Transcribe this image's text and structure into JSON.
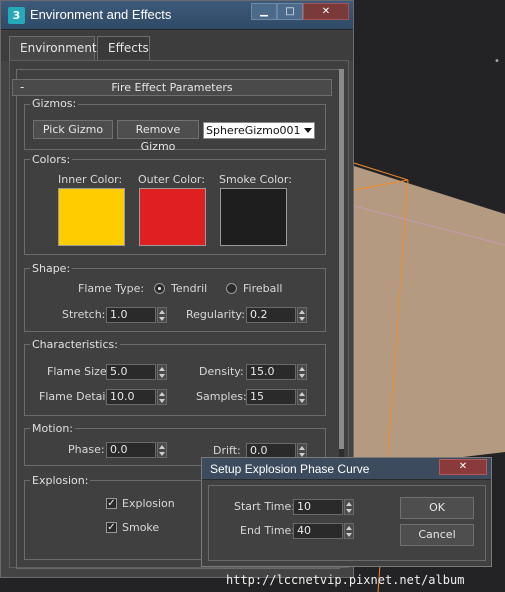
{
  "window": {
    "title": "Environment and Effects",
    "logo": "3"
  },
  "tabs": [
    {
      "label": "Environment",
      "active": true
    },
    {
      "label": "Effects",
      "active": false
    }
  ],
  "rollout": {
    "collapse_symbol": "-",
    "title": "Fire Effect Parameters"
  },
  "gizmos": {
    "group_label": "Gizmos:",
    "pick_label": "Pick Gizmo",
    "remove_label": "Remove Gizmo",
    "selected": "SphereGizmo001"
  },
  "colors": {
    "group_label": "Colors:",
    "inner": {
      "label": "Inner Color:",
      "hex": "#ffcc00"
    },
    "outer": {
      "label": "Outer Color:",
      "hex": "#e02020"
    },
    "smoke": {
      "label": "Smoke Color:",
      "hex": "#1e1e1e"
    }
  },
  "shape": {
    "group_label": "Shape:",
    "flame_type_label": "Flame Type:",
    "tendril_label": "Tendril",
    "fireball_label": "Fireball",
    "selected_flame_type": "Tendril",
    "stretch_label": "Stretch:",
    "stretch_value": "1.0",
    "regularity_label": "Regularity:",
    "regularity_value": "0.2"
  },
  "characteristics": {
    "group_label": "Characteristics:",
    "flame_size_label": "Flame Size:",
    "flame_size_value": "5.0",
    "density_label": "Density:",
    "density_value": "15.0",
    "flame_detail_label": "Flame Detail:",
    "flame_detail_value": "10.0",
    "samples_label": "Samples:",
    "samples_value": "15"
  },
  "motion": {
    "group_label": "Motion:",
    "phase_label": "Phase:",
    "phase_value": "0.0",
    "drift_label": "Drift:",
    "drift_value": "0.0"
  },
  "explosion": {
    "group_label": "Explosion:",
    "explosion_label": "Explosion",
    "explosion_checked": true,
    "smoke_label": "Smoke",
    "smoke_checked": true
  },
  "dialog": {
    "title": "Setup Explosion Phase Curve",
    "start_time_label": "Start Time:",
    "start_time_value": "10",
    "end_time_label": "End Time:",
    "end_time_value": "40",
    "ok_label": "OK",
    "cancel_label": "Cancel"
  },
  "watermark": "http://lccnetvip.pixnet.net/album",
  "colors_ui": {
    "titlebar": "#2f4a66",
    "panel": "#404040",
    "floor": "#b79a80",
    "gizmo_line": "#f08020"
  }
}
